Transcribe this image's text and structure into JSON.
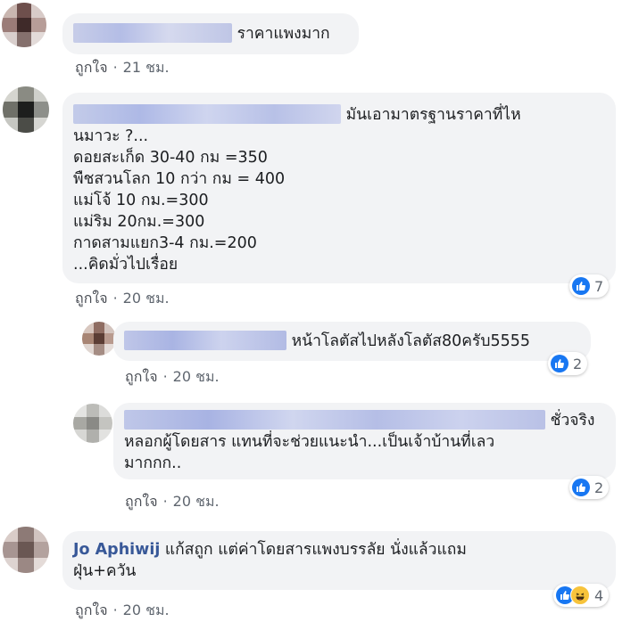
{
  "comments": [
    {
      "text_lines": [
        "ราคาแพงมาก"
      ],
      "like_label": "ถูกใจ",
      "time": "21 ชม."
    },
    {
      "text_lines": [
        "มันเอามาตรฐานราคาที่ไห",
        "นมาวะ ?...",
        "ดอยสะเก็ด 30-40 กม =350",
        "พืชสวนโลก 10 กว่า กม = 400",
        "แม่โจ้ 10 กม.=300",
        "แม่ริม 20กม.=300",
        "กาดสามแยก3-4 กม.=200",
        "...คิดมั่วไปเรื่อย"
      ],
      "like_label": "ถูกใจ",
      "time": "20 ชม.",
      "reaction_count": "7"
    },
    {
      "text_lines": [
        "หน้าโลตัสไปหลังโลตัส80ครับ5555"
      ],
      "like_label": "ถูกใจ",
      "time": "20 ชม.",
      "reaction_count": "2"
    },
    {
      "text_lines": [
        "ชั่วจริง",
        "หลอกผู้โดยสาร แทนที่จะช่วยแนะนำ...เป็นเจ้าบ้านที่เลว",
        "มากกก.."
      ],
      "like_label": "ถูกใจ",
      "time": "20 ชม.",
      "reaction_count": "2"
    },
    {
      "author": "Jo Aphiwij",
      "text_lines": [
        "แก้สถูก แต่ค่าโดยสารแพงบรรลัย นั่งแล้วแถม",
        "ฝุ่น+ควัน"
      ],
      "like_label": "ถูกใจ",
      "time": "20 ชม.",
      "reaction_count": "4"
    }
  ],
  "colors": {
    "bubble": "#f2f3f5",
    "link": "#385898",
    "like_blue": "#1877f2",
    "meta": "#606770"
  },
  "icons": [
    "like-icon",
    "haha-icon"
  ]
}
